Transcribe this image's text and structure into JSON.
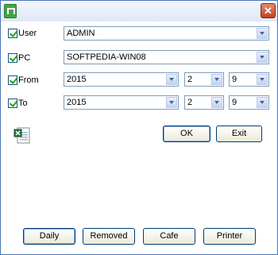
{
  "window": {
    "close_glyph": "✕"
  },
  "fields": {
    "user": {
      "label": "User",
      "value": "ADMIN"
    },
    "pc": {
      "label": "PC",
      "value": "SOFTPEDIA-WIN08"
    },
    "from": {
      "label": "From",
      "year": "2015",
      "month": "2",
      "day": "9"
    },
    "to": {
      "label": "To",
      "year": "2015",
      "month": "2",
      "day": "9"
    }
  },
  "buttons": {
    "ok": "OK",
    "exit": "Exit",
    "daily": "Daily",
    "removed": "Removed",
    "cafe": "Cafe",
    "printer": "Printer"
  },
  "icons": {
    "app": "app-logo-icon",
    "close": "close-icon",
    "excel": "excel-export-icon",
    "dropdown": "chevron-down-icon",
    "check": "checkmark-icon"
  },
  "colors": {
    "title_bar": "#dfe8f5",
    "close_button": "#c2401c",
    "check_mark": "#21a121",
    "button_border": "#003c74"
  }
}
